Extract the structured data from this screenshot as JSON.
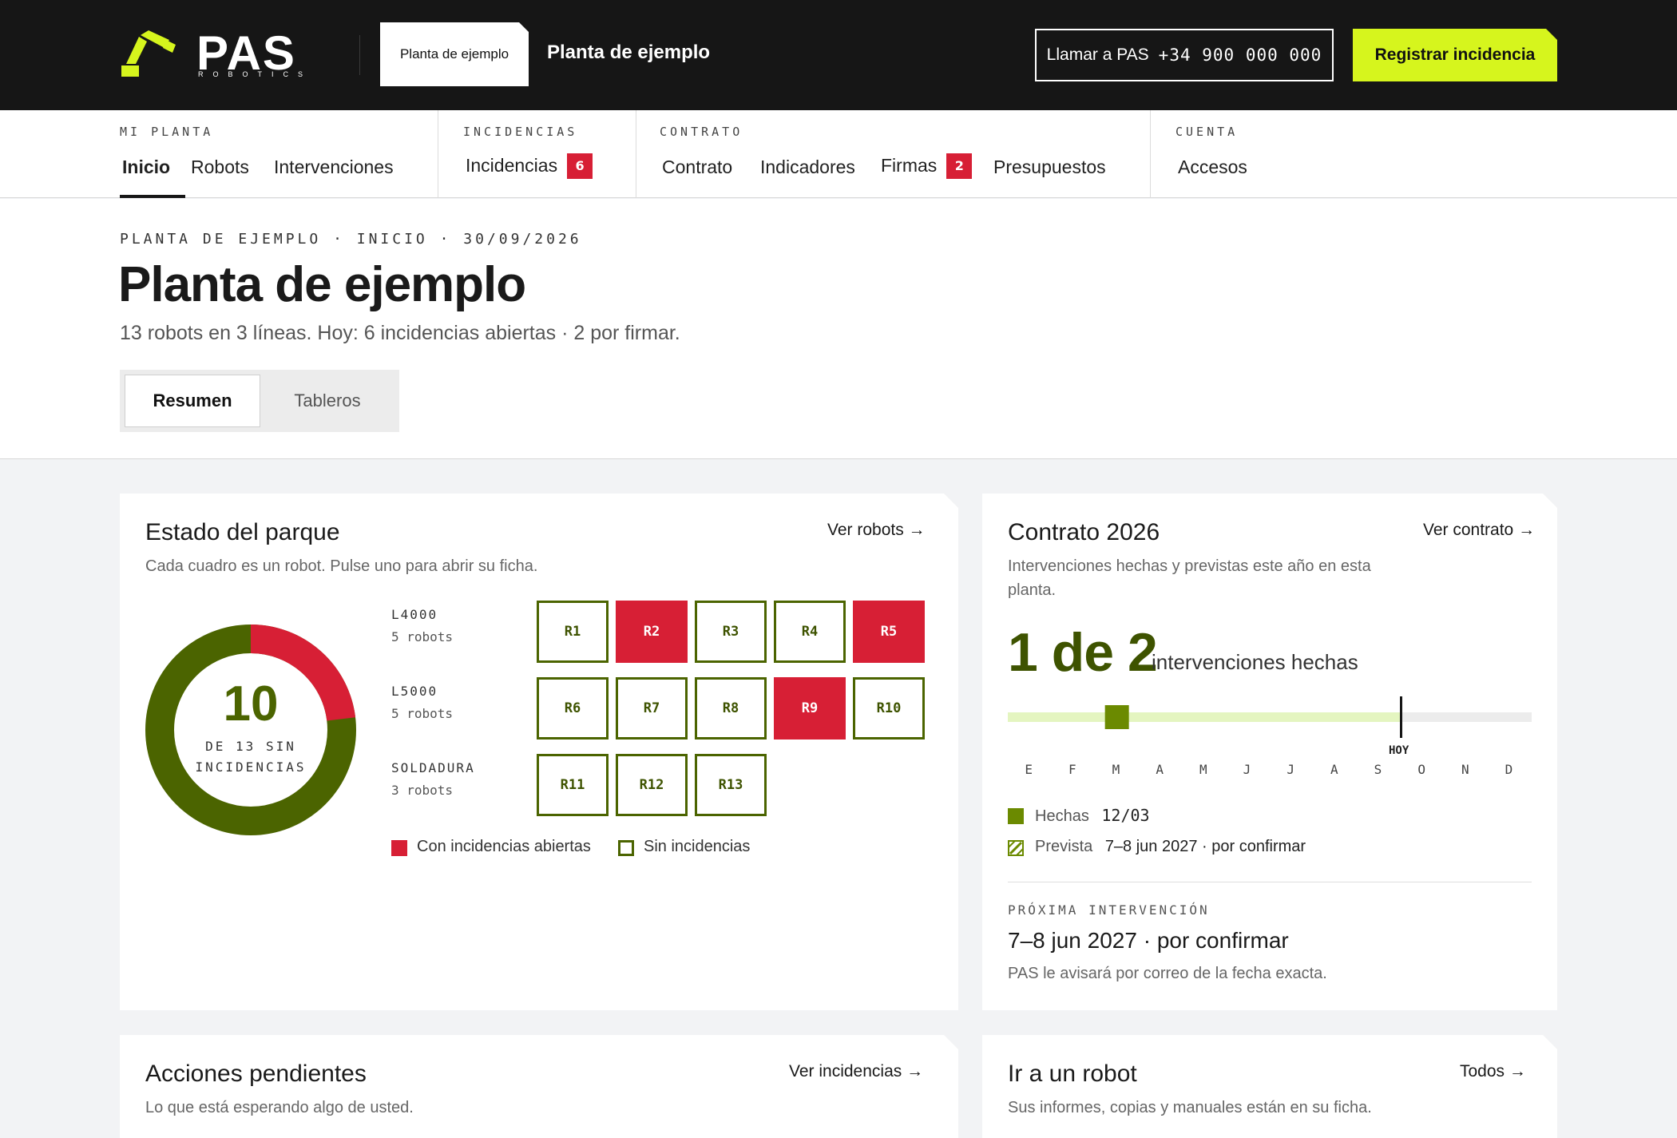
{
  "header": {
    "brand": "PAS",
    "brand_sub": "ROBOTICS",
    "plant_chip": "Planta de ejemplo",
    "plant_title": "Planta de ejemplo",
    "call_label": "Llamar a PAS",
    "call_number": "+34 900 000 000",
    "register_label": "Registrar incidencia",
    "accent_color": "#d6f51d"
  },
  "nav": {
    "groups": [
      {
        "label": "MI PLANTA",
        "items": [
          {
            "label": "Inicio",
            "active": true
          },
          {
            "label": "Robots"
          },
          {
            "label": "Intervenciones"
          }
        ]
      },
      {
        "label": "INCIDENCIAS",
        "items": [
          {
            "label": "Incidencias",
            "badge": "6"
          }
        ]
      },
      {
        "label": "CONTRATO",
        "items": [
          {
            "label": "Contrato"
          },
          {
            "label": "Indicadores"
          },
          {
            "label": "Firmas",
            "badge": "2"
          },
          {
            "label": "Presupuestos"
          }
        ]
      },
      {
        "label": "CUENTA",
        "items": [
          {
            "label": "Accesos"
          }
        ]
      }
    ]
  },
  "hero": {
    "breadcrumb": "PLANTA DE EJEMPLO · INICIO · 30/09/2026",
    "title": "Planta de ejemplo",
    "subtitle": "13 robots en 3 líneas. Hoy: 6 incidencias abiertas · 2 por firmar.",
    "tabs": [
      {
        "label": "Resumen",
        "active": true
      },
      {
        "label": "Tableros"
      }
    ]
  },
  "fleet": {
    "title": "Estado del parque",
    "subtitle": "Cada cuadro es un robot. Pulse uno para abrir su ficha.",
    "link": "Ver robots →",
    "donut": {
      "value": "10",
      "label_line1": "DE 13 SIN",
      "label_line2": "INCIDENCIAS",
      "ok": 10,
      "total": 13,
      "ok_color": "#4b6400",
      "bad_color": "#d71f35"
    },
    "lines": [
      {
        "name": "L4000",
        "count": "5 robots",
        "robots": [
          {
            "id": "R1",
            "open": false
          },
          {
            "id": "R2",
            "open": true
          },
          {
            "id": "R3",
            "open": false
          },
          {
            "id": "R4",
            "open": false
          },
          {
            "id": "R5",
            "open": true
          }
        ]
      },
      {
        "name": "L5000",
        "count": "5 robots",
        "robots": [
          {
            "id": "R6",
            "open": false
          },
          {
            "id": "R7",
            "open": false
          },
          {
            "id": "R8",
            "open": false
          },
          {
            "id": "R9",
            "open": true
          },
          {
            "id": "R10",
            "open": false
          }
        ]
      },
      {
        "name": "SOLDADURA",
        "count": "3 robots",
        "robots": [
          {
            "id": "R11",
            "open": false
          },
          {
            "id": "R12",
            "open": false
          },
          {
            "id": "R13",
            "open": false
          }
        ]
      }
    ],
    "legend": {
      "open": "Con incidencias abiertas",
      "none": "Sin incidencias"
    }
  },
  "contract": {
    "title": "Contrato 2026",
    "subtitle": "Intervenciones hechas y previstas este año en esta planta.",
    "link": "Ver contrato →",
    "count": "1 de 2",
    "count_label": "intervenciones hechas",
    "months": [
      "E",
      "F",
      "M",
      "A",
      "M",
      "J",
      "J",
      "A",
      "S",
      "O",
      "N",
      "D"
    ],
    "today_label": "HOY",
    "done_month_index": 2,
    "today_month_fraction": 0.75,
    "legend": {
      "done_label": "Hechas",
      "done_value": "12/03",
      "planned_label": "Prevista",
      "planned_value": "7–8 jun 2027 · por confirmar"
    },
    "next": {
      "label": "PRÓXIMA INTERVENCIÓN",
      "value": "7–8 jun 2027 · por confirmar",
      "note": "PAS le avisará por correo de la fecha exacta."
    }
  },
  "pending": {
    "title": "Acciones pendientes",
    "subtitle": "Lo que está esperando algo de usted.",
    "link": "Ver incidencias →"
  },
  "goto": {
    "title": "Ir a un robot",
    "subtitle": "Sus informes, copias y manuales están en su ficha.",
    "link": "Todos →"
  }
}
